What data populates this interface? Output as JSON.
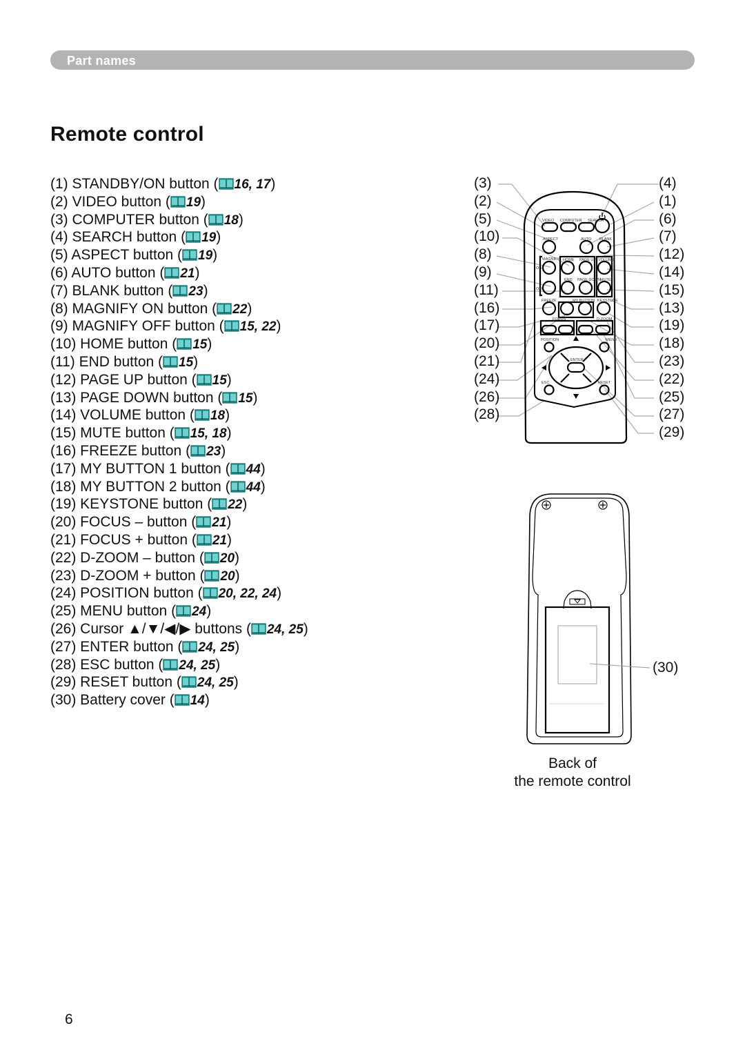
{
  "header": {
    "section": "Part names"
  },
  "title": "Remote control",
  "book_icon_color": "#2ab5b5",
  "parts": [
    {
      "label": "(1) STANDBY/ON button (",
      "pages": "16, 17"
    },
    {
      "label": "(2) VIDEO button (",
      "pages": "19"
    },
    {
      "label": "(3) COMPUTER button (",
      "pages": "18"
    },
    {
      "label": "(4) SEARCH button (",
      "pages": "19"
    },
    {
      "label": "(5) ASPECT button (",
      "pages": "19"
    },
    {
      "label": "(6) AUTO button (",
      "pages": "21"
    },
    {
      "label": "(7) BLANK button (",
      "pages": "23"
    },
    {
      "label": "(8) MAGNIFY ON button (",
      "pages": "22"
    },
    {
      "label": "(9) MAGNIFY OFF button (",
      "pages": "15, 22"
    },
    {
      "label": "(10) HOME button (",
      "pages": "15"
    },
    {
      "label": "(11) END button (",
      "pages": "15"
    },
    {
      "label": "(12) PAGE UP button (",
      "pages": "15"
    },
    {
      "label": "(13) PAGE DOWN button (",
      "pages": "15"
    },
    {
      "label": "(14) VOLUME button (",
      "pages": "18"
    },
    {
      "label": "(15) MUTE button (",
      "pages": "15, 18"
    },
    {
      "label": "(16) FREEZE button (",
      "pages": "23"
    },
    {
      "label": "(17) MY BUTTON 1 button (",
      "pages": "44"
    },
    {
      "label": "(18) MY BUTTON 2 button (",
      "pages": "44"
    },
    {
      "label": "(19) KEYSTONE button (",
      "pages": "22"
    },
    {
      "label": "(20) FOCUS – button (",
      "pages": "21"
    },
    {
      "label": "(21) FOCUS + button (",
      "pages": "21"
    },
    {
      "label": "(22) D-ZOOM – button (",
      "pages": "20"
    },
    {
      "label": "(23) D-ZOOM + button (",
      "pages": "20"
    },
    {
      "label": "(24) POSITION button (",
      "pages": "20, 22, 24"
    },
    {
      "label": "(25) MENU button (",
      "pages": "24"
    },
    {
      "label": "(26) Cursor ▲/▼/◀/▶ buttons (",
      "pages": "24, 25"
    },
    {
      "label": "(27) ENTER button (",
      "pages": "24, 25"
    },
    {
      "label": "(28) ESC button (",
      "pages": "24, 25"
    },
    {
      "label": "(29) RESET button (",
      "pages": "24, 25"
    },
    {
      "label": "(30) Battery cover (",
      "pages": "14"
    }
  ],
  "diagram": {
    "left_labels": [
      "(3)",
      "(2)",
      "(5)",
      "(10)",
      "(8)",
      "(9)",
      "(11)",
      "(16)",
      "(17)",
      "(20)",
      "(21)",
      "(24)",
      "(26)",
      "(28)"
    ],
    "right_labels": [
      "(4)",
      "(1)",
      "(6)",
      "(7)",
      "(12)",
      "(14)",
      "(15)",
      "(13)",
      "(19)",
      "(18)",
      "(23)",
      "(22)",
      "(25)",
      "(27)",
      "(29)"
    ],
    "button_texts": {
      "video": "VIDEO",
      "computer": "COMPUTER",
      "search": "SEARCH",
      "aspect": "ASPECT",
      "auto": "AUTO",
      "blank": "BLANK",
      "magnify": "MAGNIFY",
      "on": "ON",
      "off": "OFF",
      "home": "HOME",
      "page_up": "PAGE UP",
      "volume": "VOLUME",
      "end": "END",
      "page_down": "PAGE DOWN",
      "mute": "MUTE",
      "freeze": "FREEZE",
      "my_button": "MY BUTTON",
      "keystone": "KEYSTONE",
      "focus": "FOCUS",
      "d_zoom": "D-ZOOM",
      "minus": "–",
      "plus": "+",
      "position": "POSITION",
      "menu": "MENU",
      "enter": "ENTER",
      "esc": "ESC",
      "reset": "RESET"
    },
    "back_label": "(30)",
    "caption_line1": "Back of",
    "caption_line2": "the remote control"
  },
  "page_number": "6"
}
